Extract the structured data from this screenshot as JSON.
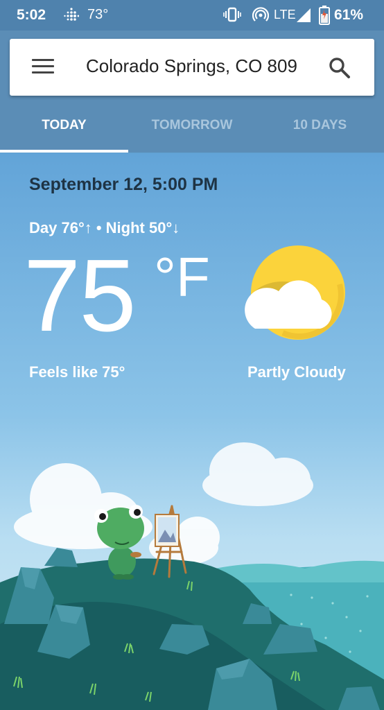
{
  "status_bar": {
    "time": "5:02",
    "temperature": "73°",
    "network": "LTE",
    "battery_percent": "61%",
    "icons": [
      "fitbit-icon",
      "vibrate-icon",
      "hotspot-icon",
      "signal-icon",
      "battery-icon"
    ]
  },
  "search": {
    "location": "Colorado Springs, CO 809"
  },
  "tabs": [
    {
      "label": "TODAY",
      "active": true
    },
    {
      "label": "TOMORROW",
      "active": false
    },
    {
      "label": "10 DAYS",
      "active": false
    }
  ],
  "weather": {
    "datetime": "September 12, 5:00 PM",
    "day_night": "Day 76°↑ • Night 50°↓",
    "temperature": "75",
    "unit": "°F",
    "feels_like": "Feels like 75°",
    "condition": "Partly Cloudy",
    "icon": "partly-cloudy-icon"
  },
  "colors": {
    "header": "#5b8db6",
    "status_bar": "#4f82ad",
    "sun": "#fbd33b"
  }
}
